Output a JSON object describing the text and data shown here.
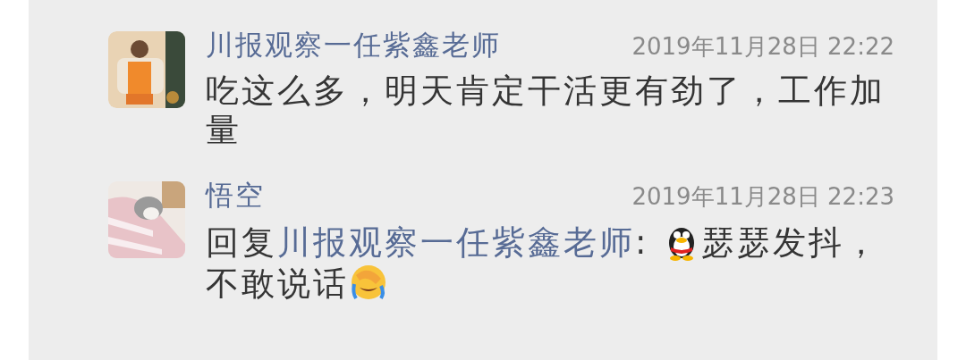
{
  "comments": [
    {
      "author": "川报观察一任紫鑫老师",
      "time": "2019年11月28日 22:22",
      "avatar": {
        "kind": "picture"
      },
      "message": [
        {
          "kind": "text",
          "text": "吃这么多，明天肯定干活更有劲了，工作加量"
        }
      ]
    },
    {
      "author": "悟空",
      "time": "2019年11月28日 22:23",
      "avatar": {
        "kind": "picture"
      },
      "message": [
        {
          "kind": "text",
          "text": "回复"
        },
        {
          "kind": "link",
          "text": "川报观察一任紫鑫老师"
        },
        {
          "kind": "text",
          "text": ": "
        },
        {
          "kind": "penguin"
        },
        {
          "kind": "text",
          "text": "瑟瑟发抖，不敢说话"
        },
        {
          "kind": "facepalm"
        }
      ]
    }
  ]
}
